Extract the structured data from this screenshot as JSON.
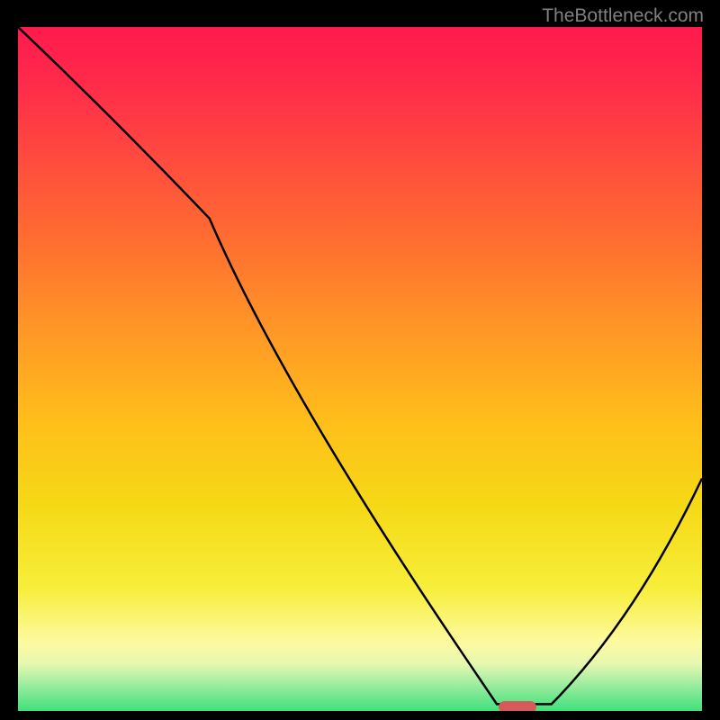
{
  "watermark": "TheBottleneck.com",
  "chart_data": {
    "type": "line",
    "title": "",
    "xlabel": "",
    "ylabel": "",
    "xlim": [
      0,
      100
    ],
    "ylim": [
      0,
      100
    ],
    "series": [
      {
        "name": "curve",
        "x": [
          0,
          28,
          70,
          78,
          100
        ],
        "y": [
          100,
          72,
          1,
          1,
          34
        ]
      }
    ],
    "marker": {
      "x": 73,
      "y": 0.5,
      "color": "#d65a5a"
    },
    "background_gradient": {
      "top": "#ff1a4d",
      "bottom": "#3fe07a"
    }
  }
}
